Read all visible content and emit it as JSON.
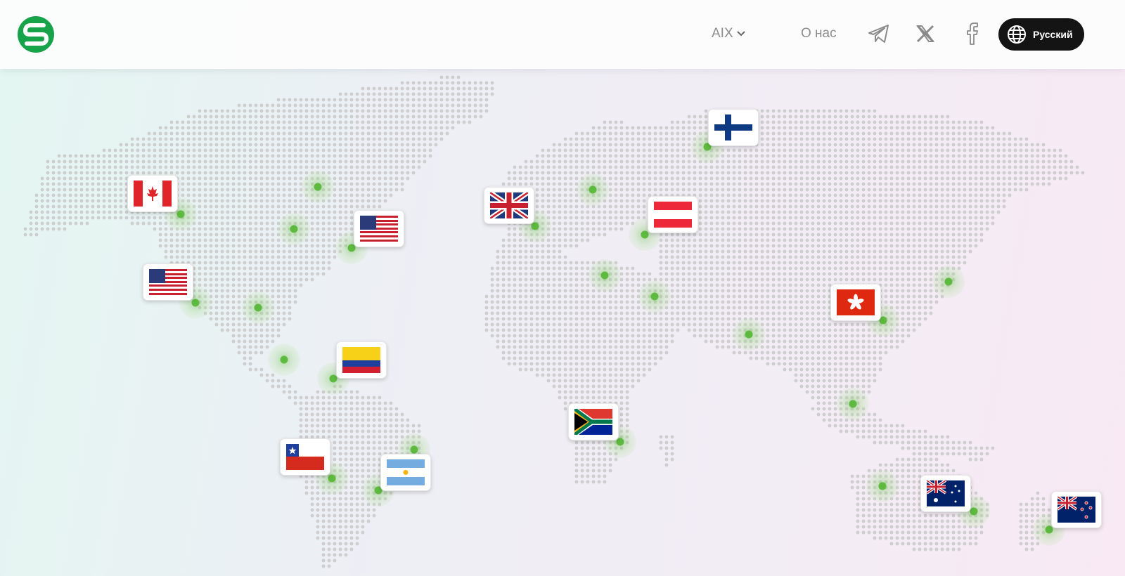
{
  "header": {
    "logo_icon": "logo-s-icon",
    "brand_color": "#16a34a",
    "nav": [
      {
        "label": "AIX",
        "has_dropdown": true
      },
      {
        "label": "О нас",
        "has_dropdown": false
      }
    ],
    "social": [
      {
        "name": "telegram-icon"
      },
      {
        "name": "x-icon"
      },
      {
        "name": "facebook-icon"
      }
    ],
    "language_button": {
      "label": "Русский",
      "icon": "globe-icon",
      "color": "#141414"
    }
  },
  "map": {
    "dot_color": "#cdcdcd",
    "marker_color": "#5dba3f",
    "flags": [
      "Canada",
      "USA",
      "USA",
      "Colombia",
      "Chile",
      "Argentina",
      "United Kingdom",
      "Austria",
      "Finland",
      "South Africa",
      "Hong Kong",
      "Australia",
      "New Zealand"
    ]
  }
}
